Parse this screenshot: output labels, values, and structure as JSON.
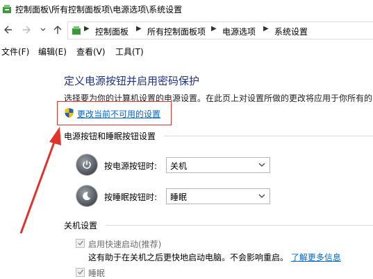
{
  "window": {
    "title": "控制面板\\所有控制面板项\\电源选项\\系统设置"
  },
  "address_bar": {
    "crumbs": [
      "控制面板",
      "所有控制面板项",
      "电源选项",
      "系统设置"
    ]
  },
  "menu": {
    "items": [
      "文件(F)",
      "编辑(E)",
      "查看(V)",
      "工具(T)"
    ]
  },
  "page": {
    "heading": "定义电源按钮并启用密码保护",
    "description": "选择要为你的计算机设置的电源设置。在此页上对设置所做的更改将应用于你所有的",
    "change_link": "更改当前不可用的设置"
  },
  "power_section": {
    "title": "电源按钮和睡眠按钮设置",
    "power_button_label": "按电源按钮时:",
    "power_button_value": "关机",
    "sleep_button_label": "按睡眠按钮时:",
    "sleep_button_value": "睡眠"
  },
  "shutdown_section": {
    "title": "关机设置",
    "fast_startup_label": "启用快速启动(推荐)",
    "fast_startup_checked": true,
    "fast_startup_note": "这有助于在关机之后更快地启动电脑。不会影响重启。",
    "learn_more": "了解更多信息",
    "sleep_label": "睡眠",
    "sleep_checked": true
  },
  "colors": {
    "heading": "#1e3287",
    "link": "#0066cc",
    "highlight": "#e0332b"
  }
}
